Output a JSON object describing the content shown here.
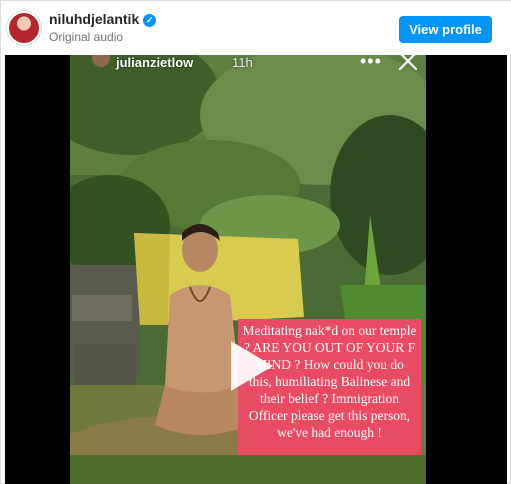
{
  "header": {
    "username": "niluhdjelantik",
    "subtitle": "Original audio",
    "view_profile_label": "View profile"
  },
  "story": {
    "username": "julianzietlow",
    "time": "11h",
    "caption": "Meditating nak*d on our temple ? ARE YOU OUT OF YOUR F MIND ? How could you do this, humiliating Balinese and their belief ? Immigration Officer please get this person, we've had enough !"
  },
  "icons": {
    "verified": "verified-badge-icon",
    "more": "more-options-icon",
    "close": "close-icon",
    "play": "play-icon"
  },
  "colors": {
    "accent": "#0095f6",
    "caption_bg": "#e84b63"
  }
}
